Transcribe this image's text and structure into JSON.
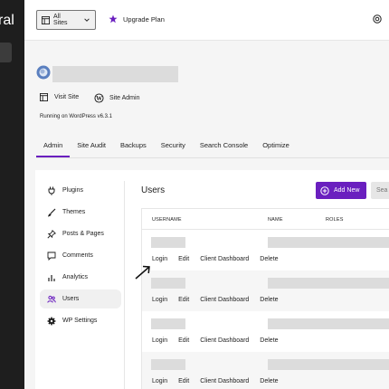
{
  "sidebar": {
    "brand_fragment": "ral"
  },
  "topbar": {
    "sites_label": "All Sites",
    "upgrade_label": "Upgrade Plan"
  },
  "site": {
    "visit_site": "Visit Site",
    "site_admin": "Site Admin",
    "running_on": "Running on WordPress v6.3.1"
  },
  "tabs": [
    {
      "label": "Admin",
      "active": true
    },
    {
      "label": "Site Audit"
    },
    {
      "label": "Backups"
    },
    {
      "label": "Security"
    },
    {
      "label": "Search Console"
    },
    {
      "label": "Optimize"
    }
  ],
  "nav": [
    {
      "label": "Plugins",
      "icon": "plug-icon"
    },
    {
      "label": "Themes",
      "icon": "brush-icon"
    },
    {
      "label": "Posts & Pages",
      "icon": "pin-icon"
    },
    {
      "label": "Comments",
      "icon": "comment-icon"
    },
    {
      "label": "Analytics",
      "icon": "bar-chart-icon"
    },
    {
      "label": "Users",
      "icon": "users-icon",
      "active": true
    },
    {
      "label": "WP Settings",
      "icon": "gear-icon"
    }
  ],
  "users": {
    "title": "Users",
    "add_new": "Add New",
    "search_label": "Sea",
    "columns": {
      "username": "USERNAME",
      "name": "NAME",
      "roles": "ROLES"
    },
    "row_actions": [
      "Login",
      "Edit",
      "Client Dashboard",
      "Delete"
    ]
  },
  "colors": {
    "accent": "#6a1fbf",
    "sidebar": "#1e1e1e"
  }
}
